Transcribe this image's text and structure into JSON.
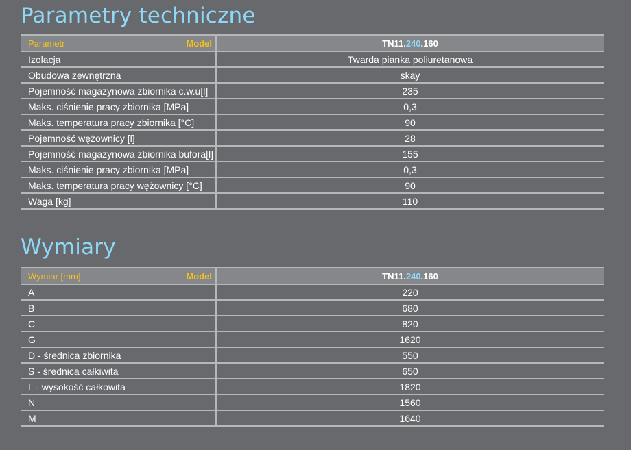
{
  "colors": {
    "background": "#68696d",
    "title": "#8ed8f8",
    "header_label": "#f6c21a",
    "header_row_bg": "#86878a",
    "row_border": "#b6b7b9",
    "model_highlight": "#8ed8f8"
  },
  "parameters": {
    "title": "Parametry techniczne",
    "header": {
      "param_label": "Parametr",
      "model_label": "Model",
      "model_prefix": "TN11.",
      "model_mid": "240",
      "model_suffix": ".160"
    },
    "rows": [
      {
        "label": "Izolacja",
        "value": "Twarda pianka poliuretanowa"
      },
      {
        "label": "Obudowa zewnętrzna",
        "value": "skay"
      },
      {
        "label": "Pojemność magazynowa zbiornika c.w.u[l]",
        "value": "235"
      },
      {
        "label": "Maks. ciśnienie pracy zbiornika [MPa]",
        "value": "0,3"
      },
      {
        "label": "Maks. temperatura pracy zbiornika [°C]",
        "value": "90"
      },
      {
        "label": "Pojemność wężownicy [l]",
        "value": "28"
      },
      {
        "label": "Pojemność magazynowa zbiornika bufora[l]",
        "value": "155"
      },
      {
        "label": "Maks. ciśnienie pracy zbiornika [MPa]",
        "value": "0,3"
      },
      {
        "label": "Maks. temperatura pracy wężownicy [°C]",
        "value": "90"
      },
      {
        "label": "Waga [kg]",
        "value": "110"
      }
    ]
  },
  "dimensions": {
    "title": "Wymiary",
    "header": {
      "param_label": "Wymiar [mm]",
      "model_label": "Model",
      "model_prefix": "TN11.",
      "model_mid": "240",
      "model_suffix": ".160"
    },
    "rows": [
      {
        "label": "A",
        "value": "220"
      },
      {
        "label": "B",
        "value": "680"
      },
      {
        "label": "C",
        "value": "820"
      },
      {
        "label": "G",
        "value": "1620"
      },
      {
        "label": "D - średnica zbiornika",
        "value": "550"
      },
      {
        "label": "S - średnica całkiwita",
        "value": "650"
      },
      {
        "label": "L - wysokość całkowita",
        "value": "1820"
      },
      {
        "label": "N",
        "value": "1560"
      },
      {
        "label": "M",
        "value": "1640"
      }
    ]
  }
}
